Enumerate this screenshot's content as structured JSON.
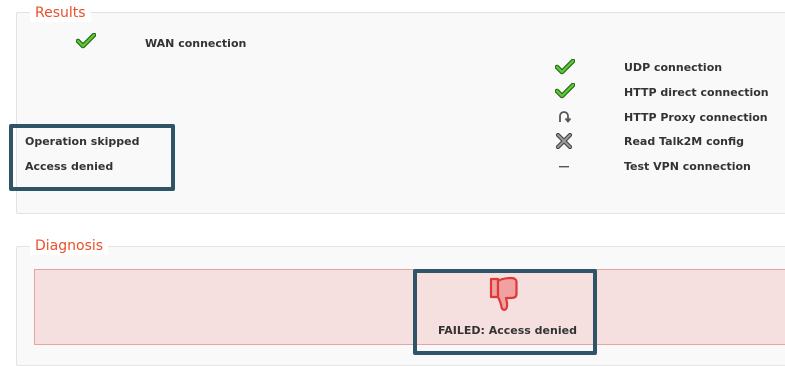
{
  "results": {
    "legend": "Results",
    "wan_label": "WAN connection",
    "checks": [
      {
        "label": "UDP connection",
        "status": "ok",
        "icon": "check-icon"
      },
      {
        "label": "HTTP direct connection",
        "status": "ok",
        "icon": "check-icon"
      },
      {
        "label": "HTTP Proxy connection",
        "status": "skipped",
        "icon": "skip-icon"
      },
      {
        "label": "Read Talk2M config",
        "status": "denied",
        "icon": "cross-icon"
      },
      {
        "label": "Test VPN connection",
        "status": "not-run",
        "icon": "dash-icon"
      }
    ],
    "key": {
      "skipped": "Operation skipped",
      "denied": "Access denied"
    }
  },
  "diagnosis": {
    "legend": "Diagnosis",
    "message": "FAILED: Access denied",
    "icon": "thumbs-down-icon"
  },
  "colors": {
    "accent": "#e8502c",
    "check_green": "#3c9a1e",
    "highlight_border": "#2f5468",
    "fail_bg": "#f6dfdf",
    "fail_border": "#e5a3a3"
  }
}
